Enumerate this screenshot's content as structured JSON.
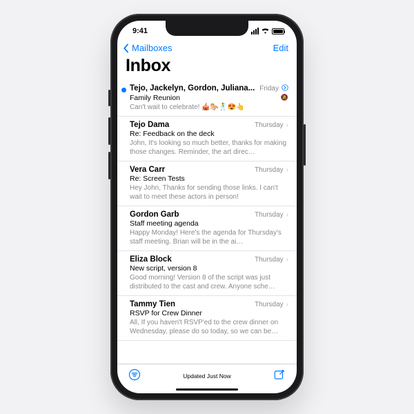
{
  "status": {
    "time": "9:41"
  },
  "nav": {
    "back": "Mailboxes",
    "edit": "Edit"
  },
  "title": "Inbox",
  "toolbar": {
    "status": "Updated Just Now"
  },
  "emails": [
    {
      "sender": "Tejo, Jackelyn, Gordon, Juliana...",
      "subject": "Family Reunion",
      "preview": "Can't wait to celebrate! 🎪🐎🕺😍👆",
      "date": "Friday",
      "unread": true,
      "thread": true,
      "muted": true
    },
    {
      "sender": "Tejo Dama",
      "subject": "Re: Feedback on the deck",
      "preview": "John, It's looking so much better, thanks for making those changes. Reminder, the art direc…",
      "date": "Thursday"
    },
    {
      "sender": "Vera Carr",
      "subject": "Re: Screen Tests",
      "preview": "Hey John, Thanks for sending those links. I can't wait to meet these actors in person!",
      "date": "Thursday"
    },
    {
      "sender": "Gordon Garb",
      "subject": "Staff meeting agenda",
      "preview": "Happy Monday! Here's the agenda for Thursday's staff meeting. Brian will be in the ai…",
      "date": "Thursday"
    },
    {
      "sender": "Eliza Block",
      "subject": "New script, version 8",
      "preview": "Good morning! Version 8 of the script was just distributed to the cast and crew. Anyone sche…",
      "date": "Thursday"
    },
    {
      "sender": "Tammy Tien",
      "subject": "RSVP for Crew Dinner",
      "preview": "All, If you haven't RSVP'ed to the crew dinner on Wednesday, please do so today, so we can be…",
      "date": "Thursday"
    }
  ]
}
